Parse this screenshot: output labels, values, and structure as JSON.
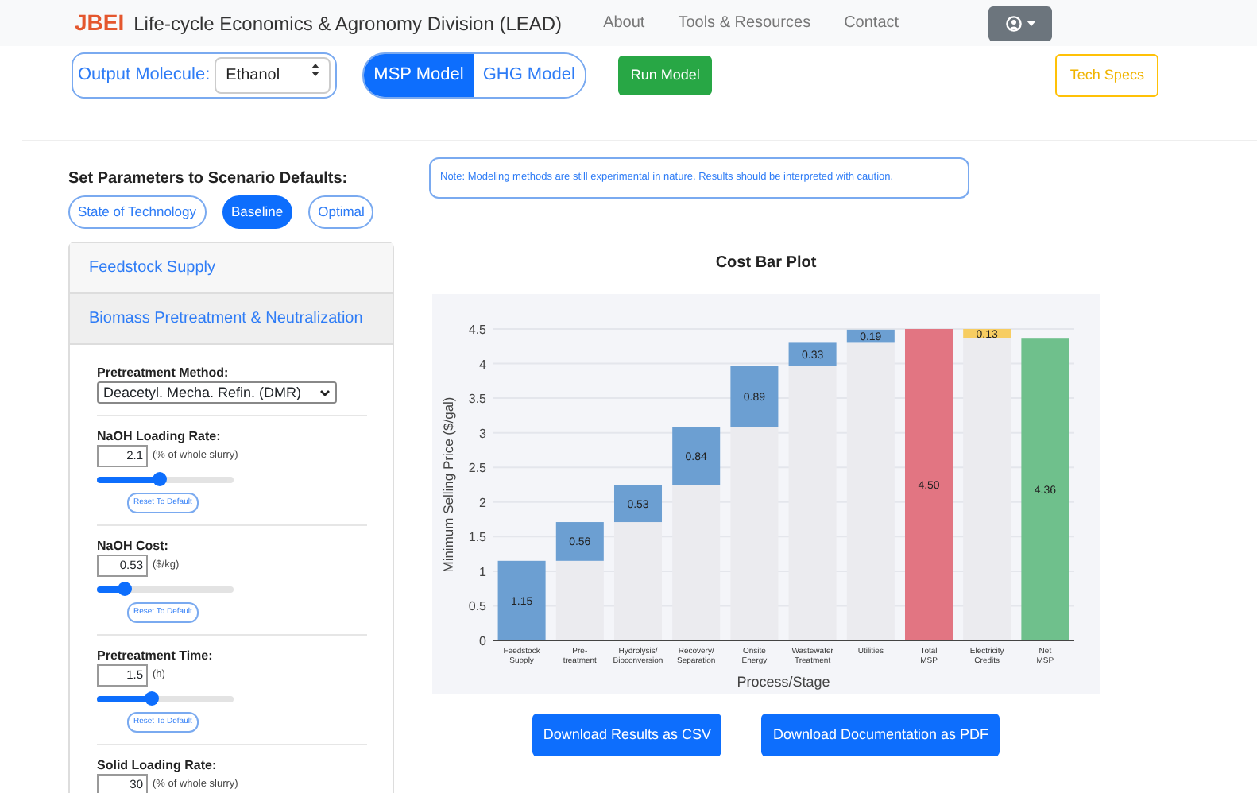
{
  "navbar": {
    "brand_mark": "JBEI",
    "brand_title": "Life-cycle Economics & Agronomy Division (LEAD)",
    "links": [
      "About",
      "Tools & Resources",
      "Contact"
    ]
  },
  "toolbar": {
    "output_label": "Output Molecule:",
    "output_value": "Ethanol",
    "models": [
      {
        "label": "MSP Model",
        "selected": true
      },
      {
        "label": "GHG Model",
        "selected": false
      }
    ],
    "run_button": "Run Model",
    "tech_button": "Tech Specs"
  },
  "scenario": {
    "heading": "Set Parameters to Scenario Defaults:",
    "options": [
      {
        "label": "State of Technology",
        "selected": false
      },
      {
        "label": "Baseline",
        "selected": true
      },
      {
        "label": "Optimal",
        "selected": false
      }
    ]
  },
  "note": "Note: Modeling methods are still experimental in nature. Results should be interpreted with caution.",
  "sections": [
    {
      "title": "Feedstock Supply"
    },
    {
      "title": "Biomass Pretreatment & Neutralization",
      "parameters": [
        {
          "kind": "select",
          "label": "Pretreatment Method:",
          "value": "Deacetyl. Mecha. Refin. (DMR)"
        },
        {
          "kind": "slider",
          "label": "NaOH Loading Rate:",
          "value": "2.1",
          "unit": "(% of whole slurry)",
          "level": 0.45,
          "reset": "Reset To Default"
        },
        {
          "kind": "slider",
          "label": "NaOH Cost:",
          "value": "0.53",
          "unit": "($/kg)",
          "level": 0.2,
          "reset": "Reset To Default"
        },
        {
          "kind": "slider",
          "label": "Pretreatment Time:",
          "value": "1.5",
          "unit": "(h)",
          "level": 0.4,
          "reset": "Reset To Default"
        },
        {
          "kind": "slider",
          "label": "Solid Loading Rate:",
          "value": "30",
          "unit": "(% of whole slurry)"
        }
      ]
    }
  ],
  "chart": {
    "chart_data": {
      "type": "bar",
      "title": "Cost Bar Plot",
      "xlabel": "Process/Stage",
      "ylabel": "Minimum Selling Price ($/gal)",
      "stacked": true,
      "categories": [
        "Feedstock\nSupply",
        "Pre-\ntreatment",
        "Hydrolysis/\nBioconversion",
        "Recovery/\nSeparation",
        "Onsite\nEnergy",
        "Wastewater\nTreatment",
        "Utilities",
        "Total\nMSP",
        "Electricity\nCredits",
        "Net\nMSP"
      ],
      "ylim": [
        0,
        4.5
      ],
      "grid": true,
      "yticks": [
        0,
        0.5,
        1,
        1.5,
        2,
        2.5,
        3,
        3.5,
        4,
        4.5
      ],
      "series": [
        {
          "color": "#ebebef",
          "values": [
            null,
            1.15,
            1.71,
            2.24,
            3.08,
            3.97,
            4.3,
            null,
            4.37,
            null
          ]
        },
        {
          "color": "#6c9fd2",
          "values": [
            1.15,
            0.56,
            0.53,
            0.84,
            0.89,
            0.33,
            0.19,
            null,
            null,
            null
          ]
        },
        {
          "color": "#e27582",
          "values": [
            null,
            null,
            null,
            null,
            null,
            null,
            null,
            4.5,
            null,
            null
          ]
        },
        {
          "color": "#f7cd62",
          "values": [
            null,
            null,
            null,
            null,
            null,
            null,
            null,
            null,
            0.13,
            null
          ]
        },
        {
          "color": "#6fc08c",
          "values": [
            null,
            null,
            null,
            null,
            null,
            null,
            null,
            null,
            null,
            4.36
          ]
        }
      ],
      "value_labels": [
        "1.15",
        "0.56",
        "0.53",
        "0.84",
        "0.89",
        "0.33",
        "0.19",
        "4.50",
        "0.13",
        "4.36"
      ]
    }
  },
  "downloads": [
    "Download Results as CSV",
    "Download Documentation as PDF"
  ]
}
